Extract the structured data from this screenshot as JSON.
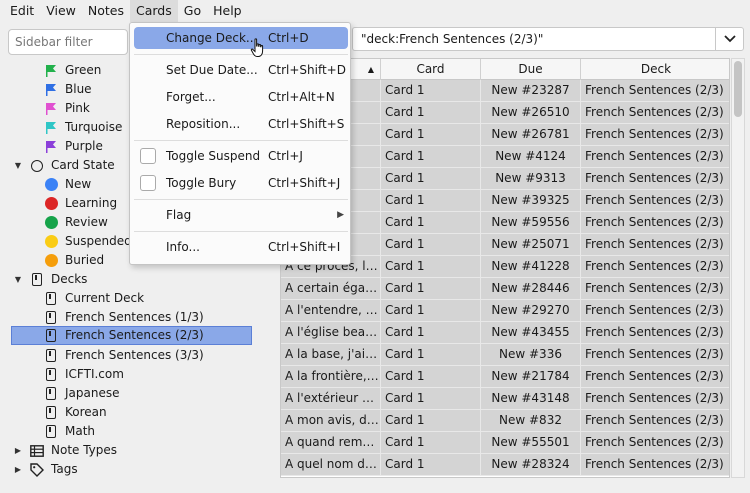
{
  "menubar": [
    "Edit",
    "View",
    "Notes",
    "Cards",
    "Go",
    "Help"
  ],
  "sidebar": {
    "filter_placeholder": "Sidebar filter",
    "flags": [
      {
        "label": "Green",
        "color": "#22b14c"
      },
      {
        "label": "Blue",
        "color": "#2f6fe4"
      },
      {
        "label": "Pink",
        "color": "#e050d0"
      },
      {
        "label": "Turquoise",
        "color": "#2fc6c6"
      },
      {
        "label": "Purple",
        "color": "#8b3fd9"
      }
    ],
    "card_state": {
      "label": "Card State",
      "items": [
        {
          "label": "New",
          "color": "#3b82f6"
        },
        {
          "label": "Learning",
          "color": "#dc2626"
        },
        {
          "label": "Review",
          "color": "#16a34a"
        },
        {
          "label": "Suspended",
          "color": "#facc15"
        },
        {
          "label": "Buried",
          "color": "#f59e0b"
        }
      ]
    },
    "decks": {
      "label": "Decks",
      "items": [
        "Current Deck",
        "French Sentences (1/3)",
        "French Sentences (2/3)",
        "French Sentences (3/3)",
        "ICFTI.com",
        "Japanese",
        "Korean",
        "Math"
      ],
      "selected": "French Sentences (2/3)"
    },
    "note_types": "Note Types",
    "tags": "Tags"
  },
  "search": {
    "value": "\"deck:French Sentences (2/3)\""
  },
  "table": {
    "columns": [
      "",
      "Card",
      "Due",
      "Deck"
    ],
    "rows": [
      {
        "sort": "…e…",
        "card": "Card 1",
        "due": "New #23287",
        "deck": "French Sentences (2/3)"
      },
      {
        "sort": "…st-…",
        "card": "Card 1",
        "due": "New #26510",
        "deck": "French Sentences (2/3)"
      },
      {
        "sort": "…st…",
        "card": "Card 1",
        "due": "New #26781",
        "deck": "French Sentences (2/3)"
      },
      {
        "sort": "…o…",
        "card": "Card 1",
        "due": "New #4124",
        "deck": "French Sentences (2/3)"
      },
      {
        "sort": "…me…",
        "card": "Card 1",
        "due": "New #9313",
        "deck": "French Sentences (2/3)"
      },
      {
        "sort": "…nt …",
        "card": "Card 1",
        "due": "New #39325",
        "deck": "French Sentences (2/3)"
      },
      {
        "sort": "…r …",
        "card": "Card 1",
        "due": "New #59556",
        "deck": "French Sentences (2/3)"
      },
      {
        "sort": "…v…",
        "card": "Card 1",
        "due": "New #25071",
        "deck": "French Sentences (2/3)"
      },
      {
        "sort": "A ce procès, le…",
        "card": "Card 1",
        "due": "New #41228",
        "deck": "French Sentences (2/3)"
      },
      {
        "sort": "A certain égard…",
        "card": "Card 1",
        "due": "New #28446",
        "deck": "French Sentences (2/3)"
      },
      {
        "sort": "A l'entendre, c'…",
        "card": "Card 1",
        "due": "New #29270",
        "deck": "French Sentences (2/3)"
      },
      {
        "sort": "A l'église beau…",
        "card": "Card 1",
        "due": "New #43455",
        "deck": "French Sentences (2/3)"
      },
      {
        "sort": "A la base, j'aim…",
        "card": "Card 1",
        "due": "New #336",
        "deck": "French Sentences (2/3)"
      },
      {
        "sort": "A la frontière, il…",
        "card": "Card 1",
        "due": "New #21784",
        "deck": "French Sentences (2/3)"
      },
      {
        "sort": "A l'extérieur ce…",
        "card": "Card 1",
        "due": "New #43148",
        "deck": "French Sentences (2/3)"
      },
      {
        "sort": "A mon avis, dit…",
        "card": "Card 1",
        "due": "New #832",
        "deck": "French Sentences (2/3)"
      },
      {
        "sort": "A quand remo…",
        "card": "Card 1",
        "due": "New #55501",
        "deck": "French Sentences (2/3)"
      },
      {
        "sort": "A quel nom doi…",
        "card": "Card 1",
        "due": "New #28324",
        "deck": "French Sentences (2/3)"
      }
    ]
  },
  "context_menu": {
    "items": [
      {
        "label": "Change Deck...",
        "shortcut": "Ctrl+D",
        "highlighted": true
      },
      {
        "label": "Set Due Date...",
        "shortcut": "Ctrl+Shift+D"
      },
      {
        "label": "Forget...",
        "shortcut": "Ctrl+Alt+N"
      },
      {
        "label": "Reposition...",
        "shortcut": "Ctrl+Shift+S"
      },
      {
        "label": "Toggle Suspend",
        "shortcut": "Ctrl+J",
        "checkbox": true
      },
      {
        "label": "Toggle Bury",
        "shortcut": "Ctrl+Shift+J",
        "checkbox": true
      },
      {
        "label": "Flag",
        "shortcut": "",
        "submenu": true
      },
      {
        "label": "Info...",
        "shortcut": "Ctrl+Shift+I"
      }
    ]
  },
  "colors": {
    "selection": "#8aa8e8",
    "row_bg": "#d4d4d4"
  }
}
